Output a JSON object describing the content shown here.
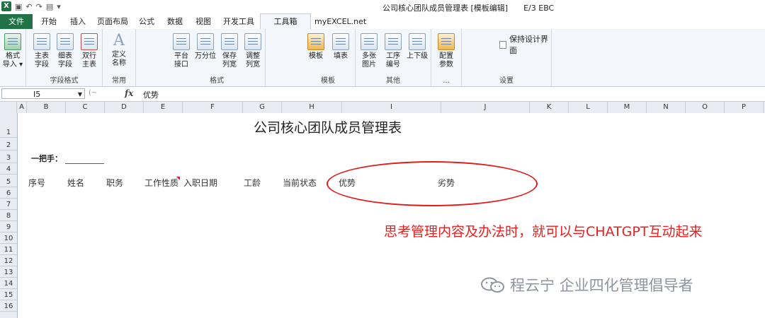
{
  "window": {
    "title": "公司核心团队成员管理表 [模板编辑]",
    "suffix": "E/3 EBC"
  },
  "tabs": [
    "文件",
    "开始",
    "插入",
    "页面布局",
    "公式",
    "数据",
    "视图",
    "开发工具",
    "工具箱",
    "myEXCEL.net"
  ],
  "active_tab": "工具箱",
  "ribbon": {
    "groups": {
      "g1": "字段格式",
      "g2": "常用",
      "g3": "格式",
      "g4": "模板",
      "g5": "其他",
      "g6": "...",
      "g7": "设置"
    },
    "buttons": {
      "b1": [
        "格式",
        "导入 ▾"
      ],
      "b2": [
        "主表",
        "字段"
      ],
      "b3": [
        "细表",
        "字段"
      ],
      "b4": [
        "双行",
        "主表"
      ],
      "b5": [
        "定义",
        "名称"
      ],
      "b6": [
        "平台",
        "接口"
      ],
      "b7": [
        "万分位",
        ""
      ],
      "b8": [
        "保存",
        "列宽"
      ],
      "b9": [
        "调整",
        "列宽"
      ],
      "b10": [
        "模板",
        ""
      ],
      "b11": [
        "填表",
        ""
      ],
      "b12": [
        "多张",
        "图片"
      ],
      "b13": [
        "工序",
        "编号"
      ],
      "b14": [
        "上下级",
        ""
      ],
      "b15": [
        "配置",
        "参数"
      ]
    },
    "keep_design": "保持设计界面"
  },
  "formula_bar": {
    "name_box": "I5",
    "fx": "fx",
    "value": "优势"
  },
  "columns": [
    "A",
    "B",
    "C",
    "D",
    "E",
    "F",
    "G",
    "H",
    "I",
    "J",
    "K",
    "L",
    "M",
    "N",
    "O",
    "P"
  ],
  "rows": [
    "1",
    "2",
    "3",
    "4",
    "5",
    "6",
    "7",
    "8",
    "9",
    "10",
    "11",
    "12",
    "13",
    "14",
    "15",
    "16"
  ],
  "sheet": {
    "title": "公司核心团队成员管理表",
    "owner_label": "一把手：",
    "headers": [
      "序号",
      "姓名",
      "职务",
      "工作性质",
      "入职日期",
      "工龄",
      "当前状态",
      "优势",
      "劣势"
    ]
  },
  "annotation": "思考管理内容及办法时，就可以与CHATGPT互动起来",
  "watermark": "程云宁 企业四化管理倡导者",
  "colors": {
    "file_tab": "#217346",
    "annotation": "#ee1c1c",
    "ellipse": "#e21c1c"
  }
}
